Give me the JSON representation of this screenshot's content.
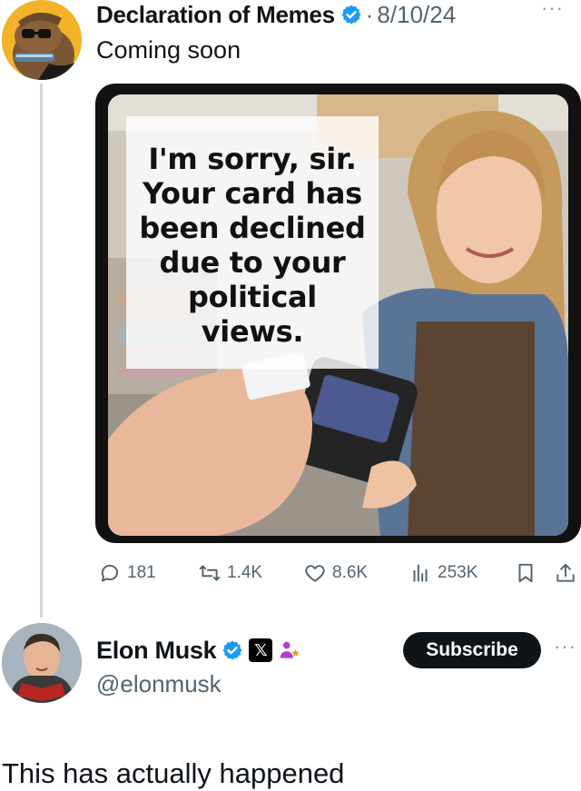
{
  "first_post": {
    "author_name": "Declaration of Memes",
    "separator": "·",
    "date": "8/10/24",
    "more_label": "···",
    "text": "Coming soon",
    "image_caption_lines": [
      "I'm sorry, sir.",
      "Your card has",
      "been declined",
      "due to your",
      "political",
      "views."
    ],
    "actions": {
      "replies": "181",
      "reposts": "1.4K",
      "likes": "8.6K",
      "views": "253K"
    }
  },
  "second_post": {
    "author_name": "Elon Musk",
    "x_badge_label": "𝕏",
    "handle": "@elonmusk",
    "subscribe_label": "Subscribe",
    "more_label": "···",
    "text": "This has actually happened"
  },
  "colors": {
    "verified_blue": "#1d9bf0",
    "secondary_text": "#536471",
    "affiliate_purple": "#b23ed6"
  },
  "icons": [
    "verified-badge-icon",
    "reply-icon",
    "repost-icon",
    "like-icon",
    "views-icon",
    "bookmark-icon",
    "share-icon",
    "affiliate-icon",
    "more-icon"
  ]
}
